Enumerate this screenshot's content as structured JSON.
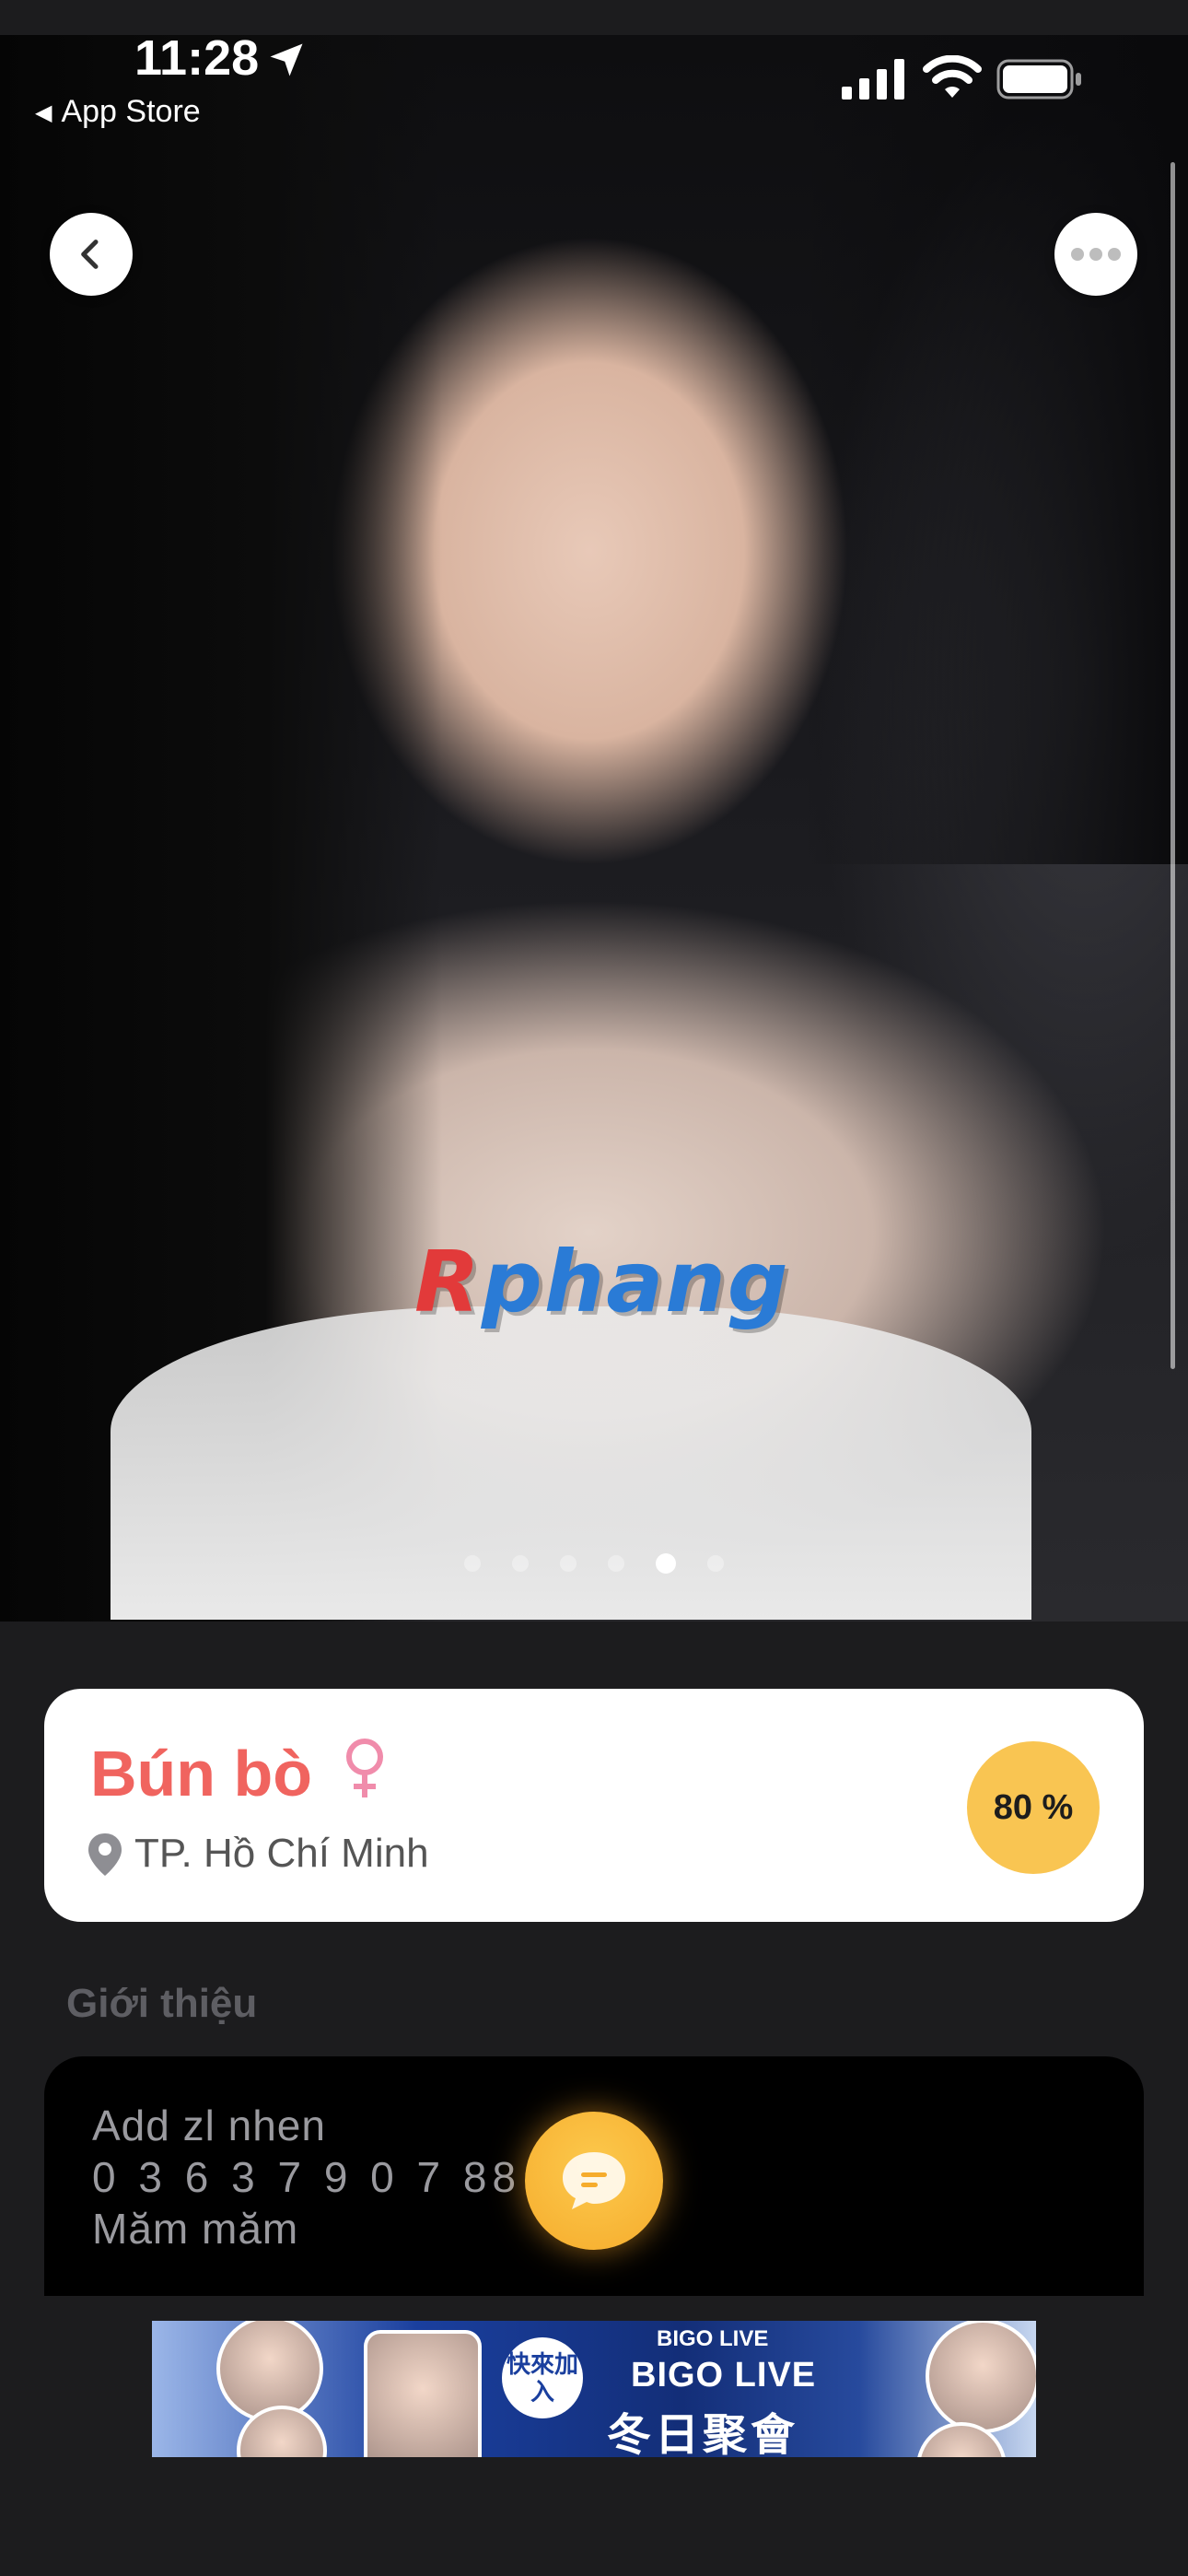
{
  "status_bar": {
    "time": "11:28",
    "back_app": "App Store"
  },
  "photo": {
    "watermark_r": "R",
    "watermark_rest": "phang",
    "page_count": 6,
    "active_page": 5
  },
  "profile": {
    "name": "Bún bò",
    "gender_symbol": "♀",
    "city": "TP. Hồ Chí Minh",
    "match_percent": "80 %"
  },
  "intro": {
    "section_title": "Giới thiệu",
    "lines": [
      "Add zl nhen",
      "0 3 6 3 7 9 0 7   88",
      "Măm măm"
    ]
  },
  "ad": {
    "brand_small": "BIGO LIVE",
    "title": "BIGO LIVE",
    "subtitle": "冬日聚會",
    "join_label": "快來加入"
  },
  "colors": {
    "name": "#f0645f",
    "badge": "#f9c552",
    "fab": "#f6ac2c"
  }
}
